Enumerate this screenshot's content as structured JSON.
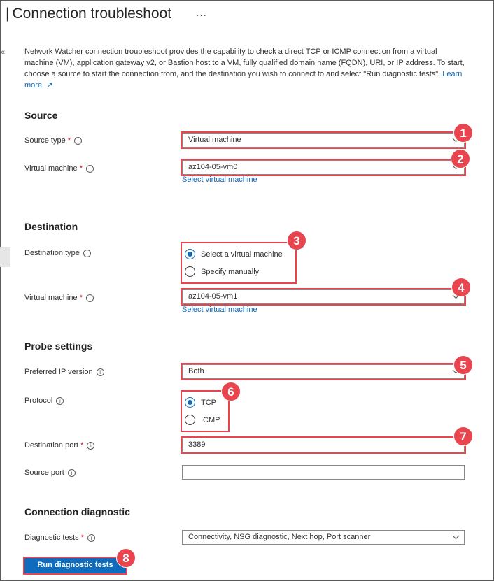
{
  "header": {
    "title": "Connection troubleshoot",
    "more_label": "···",
    "collapse_glyph": "«"
  },
  "description": {
    "text": "Network Watcher connection troubleshoot provides the capability to check a direct TCP or ICMP connection from a virtual machine (VM), application gateway v2, or Bastion host to a VM, fully qualified domain name (FQDN), URI, or IP address. To start, choose a source to start the connection from, and the destination you wish to connect to and select \"Run diagnostic tests\".",
    "learn_more": "Learn more.",
    "external_icon": "↗"
  },
  "source": {
    "title": "Source",
    "source_type_label": "Source type",
    "source_type_value": "Virtual machine",
    "vm_label": "Virtual machine",
    "vm_value": "az104-05-vm0",
    "select_vm_link": "Select virtual machine"
  },
  "destination": {
    "title": "Destination",
    "type_label": "Destination type",
    "options": [
      "Select a virtual machine",
      "Specify manually"
    ],
    "selected_option": "Select a virtual machine",
    "vm_label": "Virtual machine",
    "vm_value": "az104-05-vm1",
    "select_vm_link": "Select virtual machine"
  },
  "probe": {
    "title": "Probe settings",
    "ip_version_label": "Preferred IP version",
    "ip_version_value": "Both",
    "protocol_label": "Protocol",
    "protocol_options": [
      "TCP",
      "ICMP"
    ],
    "protocol_selected": "TCP",
    "dest_port_label": "Destination port",
    "dest_port_value": "3389",
    "source_port_label": "Source port",
    "source_port_value": ""
  },
  "diagnostic": {
    "title": "Connection diagnostic",
    "tests_label": "Diagnostic tests",
    "tests_value": "Connectivity, NSG diagnostic, Next hop, Port scanner",
    "run_button": "Run diagnostic tests"
  },
  "markers": {
    "required": "*",
    "info": "i",
    "badges": [
      "1",
      "2",
      "3",
      "4",
      "5",
      "6",
      "7",
      "8"
    ]
  },
  "colors": {
    "accent": "#0f6cbd",
    "highlight": "#e8454e",
    "required": "#c50f1f"
  }
}
